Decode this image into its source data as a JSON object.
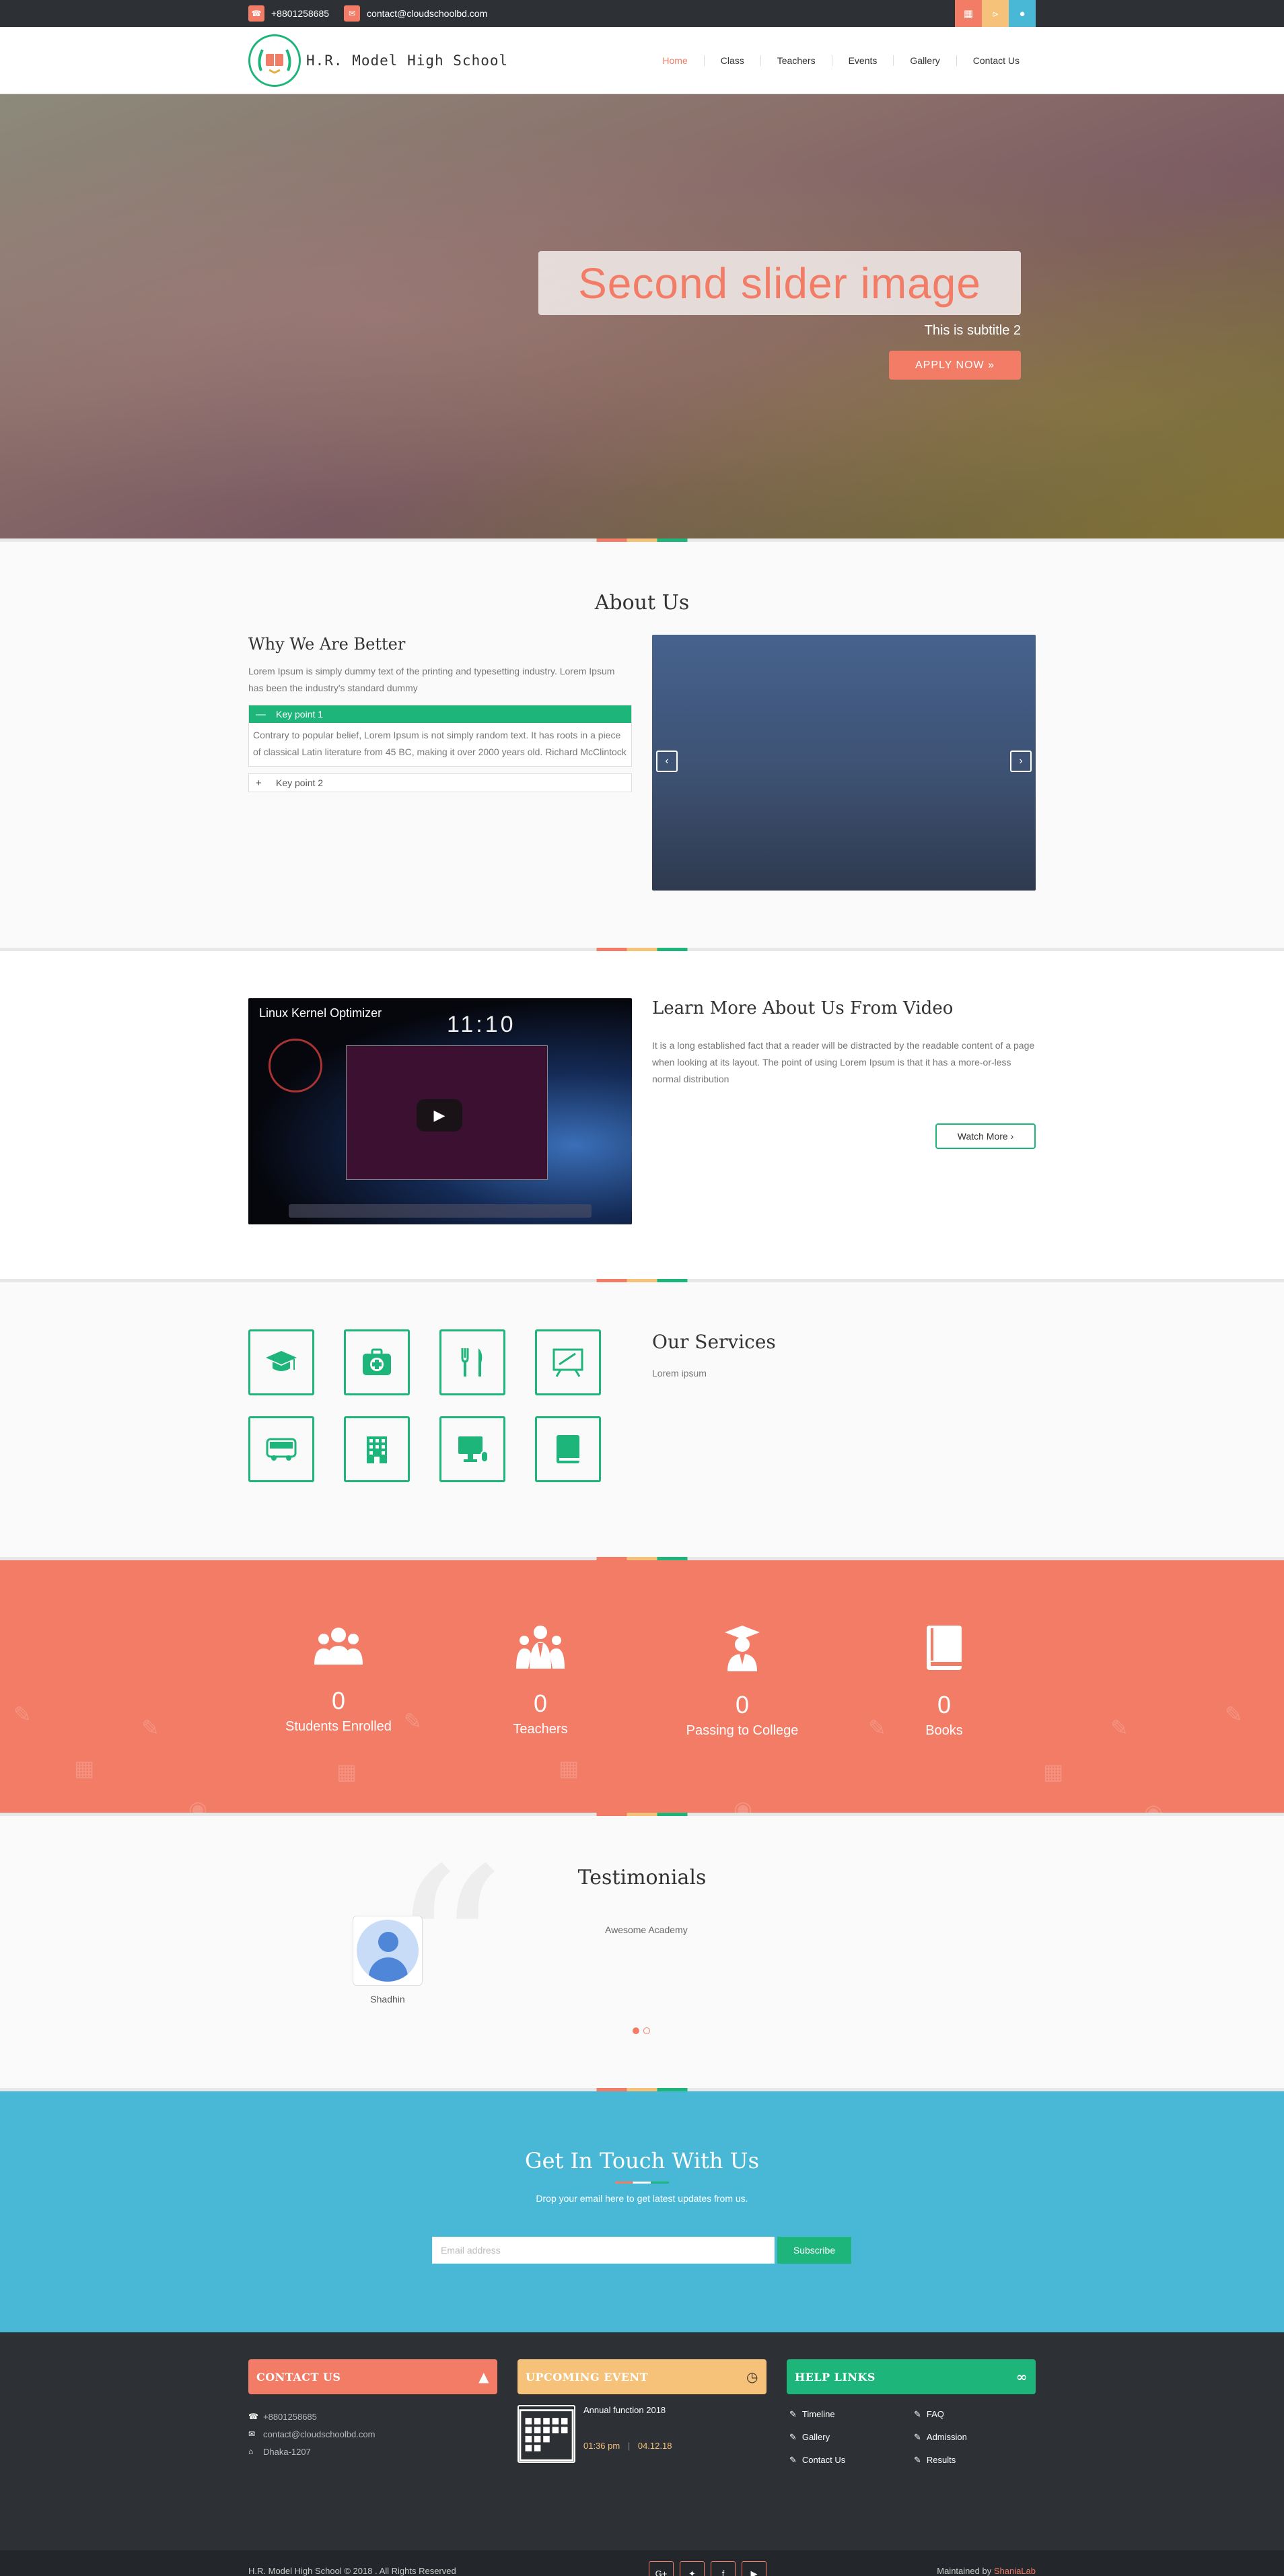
{
  "colors": {
    "coral": "#f27c66",
    "green": "#1db57a",
    "blue": "#49b8d6",
    "peach": "#f6c27a",
    "dark": "#2d3035"
  },
  "topbar": {
    "phone": "+8801258685",
    "email": "contact@cloudschoolbd.com",
    "icons": [
      "phone-icon",
      "mail-icon",
      "calendar-icon",
      "share-icon",
      "person-icon"
    ]
  },
  "header": {
    "logo_text": "H.R. Model High School",
    "nav": [
      "Home",
      "Class",
      "Teachers",
      "Events",
      "Gallery",
      "Contact Us"
    ]
  },
  "hero": {
    "title": "Second slider image",
    "subtitle": "This is subtitle 2",
    "button": "APPLY NOW »"
  },
  "about": {
    "title": "About Us",
    "subtitle": "Why We Are Better",
    "text": "Lorem Ipsum is simply dummy text of the printing and typesetting industry. Lorem Ipsum has been the industry's standard dummy",
    "key_point_1": "Key point 1",
    "key_point_1_text": "Contrary to popular belief, Lorem Ipsum is not simply random text. It has roots in a piece of classical Latin literature from 45 BC, making it over 2000 years old. Richard McClintock",
    "key_point_2": "Key point 2",
    "prev": "‹",
    "next": "›"
  },
  "video": {
    "video_title": "Linux Kernel Optimizer",
    "clock": "11:10",
    "heading": "Learn More About Us From Video",
    "text": "It is a long established fact that a reader will be distracted by the readable content of a page when looking at its layout. The point of using Lorem Ipsum is that it has a more-or-less normal distribution",
    "button": "Watch More ›"
  },
  "services": {
    "title": "Our Services",
    "text": "Lorem ipsum",
    "icons": [
      "graduation-cap-icon",
      "medical-kit-icon",
      "cutlery-icon",
      "blackboard-icon",
      "bus-icon",
      "building-icon",
      "computer-icon",
      "book-icon"
    ]
  },
  "stats": {
    "items": [
      {
        "value": "0",
        "label": "Students Enrolled",
        "icon": "group-icon"
      },
      {
        "value": "0",
        "label": "Teachers",
        "icon": "teachers-icon"
      },
      {
        "value": "0",
        "label": "Passing to College",
        "icon": "graduate-icon"
      },
      {
        "value": "0",
        "label": "Books",
        "icon": "book-icon"
      }
    ]
  },
  "testimonials": {
    "title": "Testimonials",
    "name": "Shadhin",
    "text": "Awesome Academy"
  },
  "newsletter": {
    "title": "Get In Touch With Us",
    "subtitle": "Drop your email here to get latest updates from us.",
    "placeholder": "Email address",
    "button": "Subscribe"
  },
  "footer": {
    "contact_title": "CONTACT US",
    "contact_phone": "+8801258685",
    "contact_email": "contact@cloudschoolbd.com",
    "contact_address": "Dhaka-1207",
    "event_title": "UPCOMING EVENT",
    "event_name": "Annual function 2018",
    "event_time": "01:36 pm",
    "event_date": "04.12.18",
    "help_title": "HELP LINKS",
    "help_links": [
      "Timeline",
      "FAQ",
      "Gallery",
      "Admission",
      "Contact Us",
      "Results"
    ]
  },
  "bottom": {
    "copyright": "H.R. Model High School © 2018 . All Rights Reserved",
    "maintained_label": "Maintained by",
    "maintained_by": "ShaniaLab",
    "socials": [
      "google-plus-icon",
      "twitter-icon",
      "facebook-icon",
      "youtube-icon"
    ]
  }
}
